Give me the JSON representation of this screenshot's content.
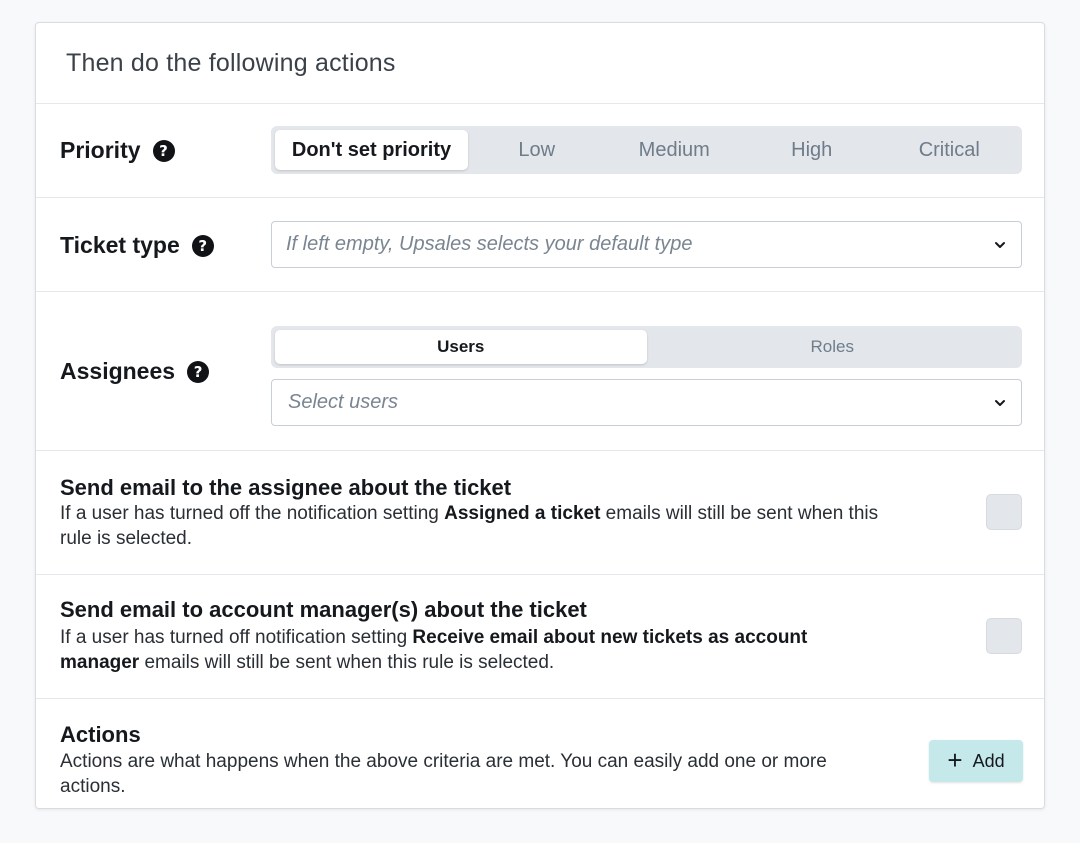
{
  "header": {
    "title": "Then do the following actions"
  },
  "priority": {
    "label": "Priority",
    "help": "?",
    "options": [
      "Don't set priority",
      "Low",
      "Medium",
      "High",
      "Critical"
    ],
    "selected": "Don't set priority"
  },
  "ticket_type": {
    "label": "Ticket type",
    "help": "?",
    "placeholder": "If left empty, Upsales selects your default type"
  },
  "assignees": {
    "label": "Assignees",
    "help": "?",
    "tabs": [
      "Users",
      "Roles"
    ],
    "selected_tab": "Users",
    "placeholder": "Select users"
  },
  "email_assignee": {
    "title": "Send email to the assignee about the ticket",
    "desc_pre": "If a user has turned off the notification setting ",
    "desc_bold": "Assigned a ticket",
    "desc_post": " emails will still be sent when this rule is selected.",
    "checked": false
  },
  "email_account_manager": {
    "title": "Send email to account manager(s) about the ticket",
    "desc_pre": "If a user has turned off notification setting ",
    "desc_bold": "Receive email about new tickets as account manager",
    "desc_post": " emails will still be sent when this rule is selected.",
    "checked": false
  },
  "actions": {
    "title": "Actions",
    "desc": "Actions are what happens when the above criteria are met. You can easily add one or more actions.",
    "add_label": "Add",
    "add_icon": "+"
  },
  "colors": {
    "accent": "#c5e8ea",
    "segment_bg": "#e3e6ea",
    "border": "#e4e7eb"
  }
}
